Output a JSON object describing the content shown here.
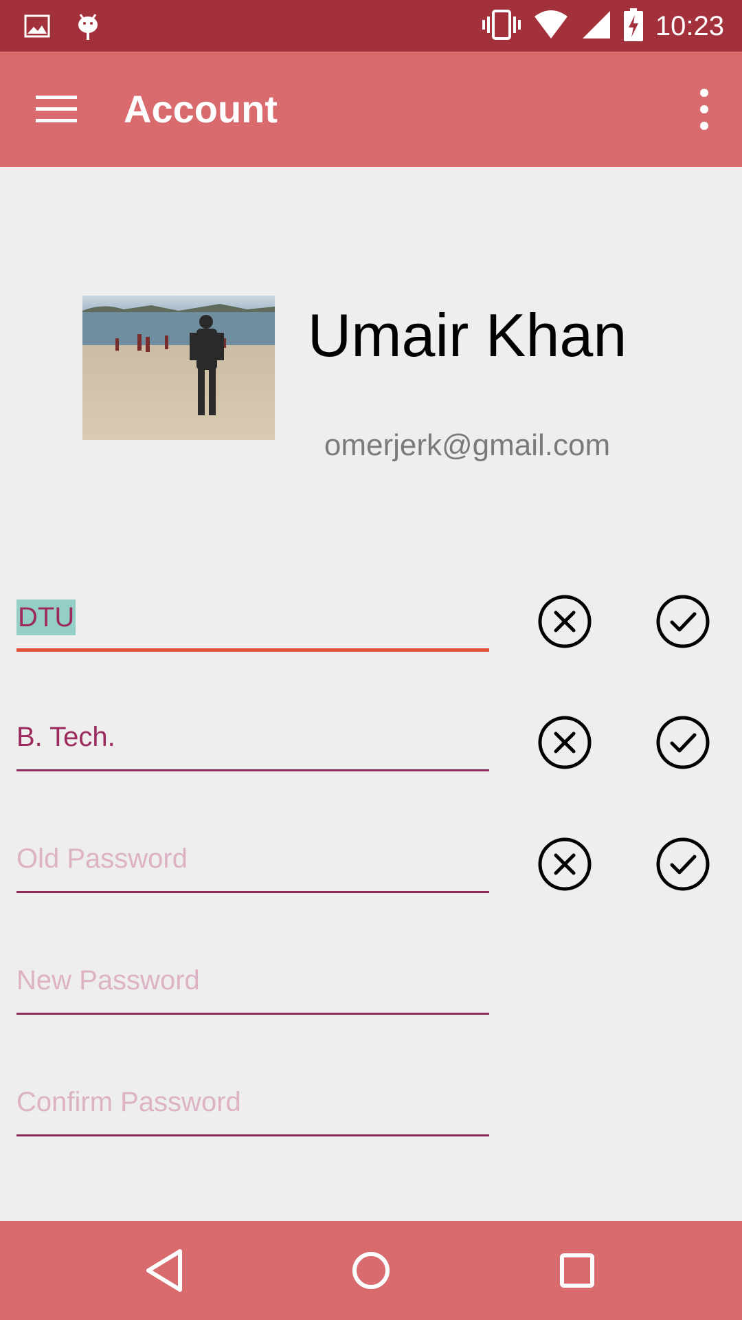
{
  "status_bar": {
    "time": "10:23",
    "icons": [
      "image-icon",
      "android-debug-icon",
      "vibrate-icon",
      "wifi-icon",
      "signal-icon",
      "battery-charging-icon"
    ]
  },
  "app_bar": {
    "title": "Account",
    "menu_icon": "hamburger-menu-icon",
    "overflow_icon": "more-vert-icon"
  },
  "profile": {
    "name": "Umair Khan",
    "email": "omerjerk@gmail.com"
  },
  "fields": [
    {
      "value": "DTU",
      "placeholder": "",
      "focused": true
    },
    {
      "value": "B. Tech.",
      "placeholder": ""
    },
    {
      "value": "",
      "placeholder": "Old Password"
    },
    {
      "value": "",
      "placeholder": "New Password"
    },
    {
      "value": "",
      "placeholder": "Confirm Password"
    }
  ],
  "colors": {
    "status_bar": "#a3313c",
    "app_bar": "#d96b6f",
    "background": "#eeeeee",
    "field_text": "#9c2a5e",
    "field_placeholder": "#dcb2c4",
    "field_line": "#8f2a5d",
    "field_line_focused": "#e0533a",
    "selection": "#93cfc5"
  },
  "nav_bar": {
    "icons": [
      "back-icon",
      "home-icon",
      "recents-icon"
    ]
  }
}
